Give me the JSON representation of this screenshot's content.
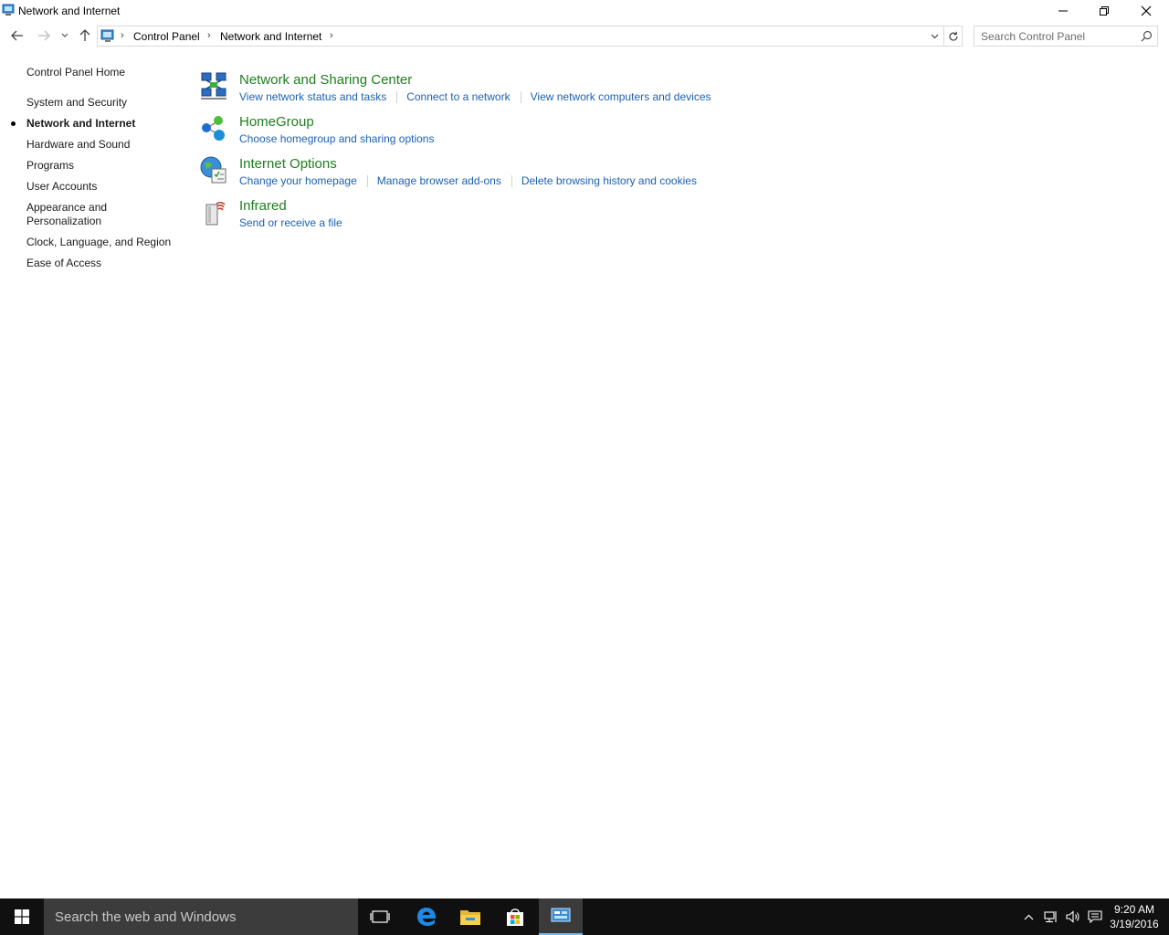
{
  "window": {
    "title": "Network and Internet"
  },
  "address": {
    "breadcrumbs": [
      "Control Panel",
      "Network and Internet"
    ],
    "search_placeholder": "Search Control Panel"
  },
  "leftpane": {
    "home_label": "Control Panel Home",
    "items": [
      {
        "label": "System and Security",
        "active": false
      },
      {
        "label": "Network and Internet",
        "active": true
      },
      {
        "label": "Hardware and Sound",
        "active": false
      },
      {
        "label": "Programs",
        "active": false
      },
      {
        "label": "User Accounts",
        "active": false
      },
      {
        "label": "Appearance and Personalization",
        "active": false
      },
      {
        "label": "Clock, Language, and Region",
        "active": false
      },
      {
        "label": "Ease of Access",
        "active": false
      }
    ]
  },
  "categories": [
    {
      "title": "Network and Sharing Center",
      "icon": "network-sharing-center-icon",
      "links": [
        "View network status and tasks",
        "Connect to a network",
        "View network computers and devices"
      ]
    },
    {
      "title": "HomeGroup",
      "icon": "homegroup-icon",
      "links": [
        "Choose homegroup and sharing options"
      ]
    },
    {
      "title": "Internet Options",
      "icon": "internet-options-icon",
      "links": [
        "Change your homepage",
        "Manage browser add-ons",
        "Delete browsing history and cookies"
      ]
    },
    {
      "title": "Infrared",
      "icon": "infrared-icon",
      "links": [
        "Send or receive a file"
      ]
    }
  ],
  "taskbar": {
    "search_text": "Search the web and Windows",
    "time": "9:20 AM",
    "date": "3/19/2016"
  },
  "colors": {
    "category_title": "#1e7e1e",
    "link": "#1a61b4",
    "taskbar": "#101010",
    "active_task_underline": "#76b9ed"
  }
}
